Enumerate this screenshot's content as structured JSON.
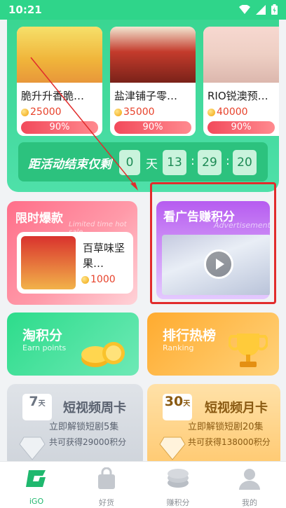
{
  "status": {
    "time": "10:21"
  },
  "products": [
    {
      "name": "脆升升香脆…",
      "price": "25000",
      "progress": "90%"
    },
    {
      "name": "盐津铺子零…",
      "price": "35000",
      "progress": "90%"
    },
    {
      "name": "RIO锐澳预…",
      "price": "40000",
      "progress": "90%"
    }
  ],
  "countdown": {
    "label": "距活动结束仅剩",
    "days": "0",
    "day_unit": "天",
    "hours": "13",
    "minutes": "29",
    "seconds": "20",
    "sep": ":"
  },
  "flash": {
    "title": "限时爆款",
    "subtitle": "Limited time hot sale",
    "product_name": "百草味坚果…",
    "price": "1000"
  },
  "ad": {
    "title": "看广告赚积分",
    "subtitle": "Advertisement"
  },
  "earn": {
    "title": "淘积分",
    "subtitle": "Earn points"
  },
  "rank": {
    "title": "排行热榜",
    "subtitle": "Ranking"
  },
  "weekly": {
    "days": "7",
    "unit": "天",
    "title": "短视频周卡",
    "line1": "立即解锁短剧5集",
    "line2": "共可获得29000积分"
  },
  "monthly": {
    "days": "30",
    "unit": "天",
    "title": "短视频月卡",
    "line1": "立即解锁短剧20集",
    "line2": "共可获得138000积分"
  },
  "tabs": [
    {
      "label": "iGO",
      "icon": "igo-logo-icon"
    },
    {
      "label": "好货",
      "icon": "shopping-bag-icon"
    },
    {
      "label": "赚积分",
      "icon": "coin-stack-icon"
    },
    {
      "label": "我的",
      "icon": "user-icon"
    }
  ],
  "colors": {
    "accent": "#2fd58a",
    "price": "#e7422b",
    "highlight": "#e12c2c"
  }
}
